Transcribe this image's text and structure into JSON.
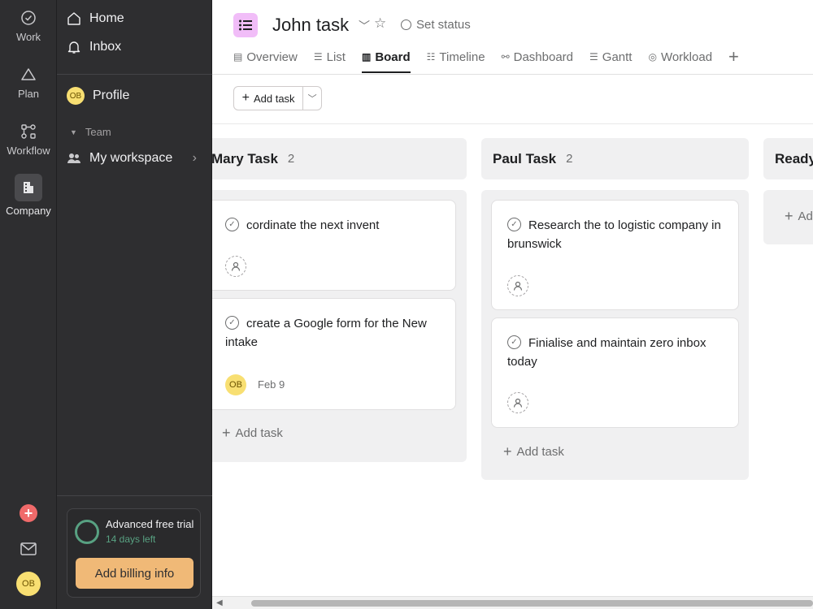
{
  "rail": {
    "items": [
      {
        "label": "Work",
        "icon": "check-circle-icon"
      },
      {
        "label": "Plan",
        "icon": "triangle-icon"
      },
      {
        "label": "Workflow",
        "icon": "workflow-icon"
      },
      {
        "label": "Company",
        "icon": "building-icon"
      }
    ],
    "create_icon": "plus-icon",
    "inbox_icon": "mail-icon",
    "avatar": "OB"
  },
  "sidebar": {
    "home": "Home",
    "inbox": "Inbox",
    "profile": "Profile",
    "profile_avatar": "OB",
    "team_section": "Team",
    "workspace": "My workspace",
    "trial": {
      "title": "Advanced free trial",
      "subtitle": "14 days left",
      "button": "Add billing info"
    }
  },
  "header": {
    "project_title": "John task",
    "set_status": "Set status",
    "tabs": [
      {
        "label": "Overview",
        "icon": "overview-icon"
      },
      {
        "label": "List",
        "icon": "list-icon"
      },
      {
        "label": "Board",
        "icon": "board-icon",
        "active": true
      },
      {
        "label": "Timeline",
        "icon": "timeline-icon"
      },
      {
        "label": "Dashboard",
        "icon": "dashboard-icon"
      },
      {
        "label": "Gantt",
        "icon": "gantt-icon"
      },
      {
        "label": "Workload",
        "icon": "workload-icon"
      }
    ]
  },
  "toolbar": {
    "add_task": "Add task"
  },
  "board": {
    "columns": [
      {
        "title": "Mary Task",
        "count": "2",
        "cards": [
          {
            "text": "cordinate the next invent"
          },
          {
            "text": "create a Google form for the New intake",
            "avatar": "OB",
            "date": "Feb 9"
          }
        ],
        "add_label": "Add task"
      },
      {
        "title": "Paul Task",
        "count": "2",
        "cards": [
          {
            "text": "Research the to logistic company in brunswick"
          },
          {
            "text": "Finialise and maintain zero inbox today"
          }
        ],
        "add_label": "Add task"
      },
      {
        "title": "Ready",
        "add_label": "Ad"
      }
    ]
  },
  "colors": {
    "sidebar_bg": "#2e2e30",
    "accent_pink": "#f1bdf8",
    "billing_button": "#f0b977",
    "trial_green": "#58a182",
    "create_red": "#f06a6a",
    "avatar_yellow": "#f8df72",
    "column_bg": "#f0f0f1"
  }
}
